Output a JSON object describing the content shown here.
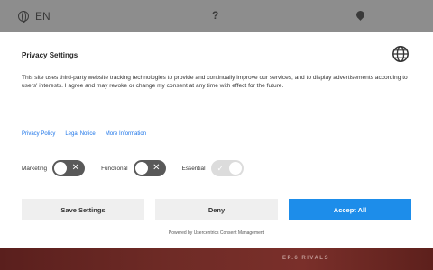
{
  "background": {
    "language": "EN",
    "help": "?",
    "bottom_tag": "EP.6 RIVALS"
  },
  "dialog": {
    "title": "Privacy Settings",
    "description": "This site uses third-party website tracking technologies to provide and continually improve our services, and to display advertisements according to users' interests. I agree and may revoke or change my consent at any time with effect for the future.",
    "links": [
      "Privacy Policy",
      "Legal Notice",
      "More Information"
    ],
    "toggles": [
      {
        "label": "Marketing",
        "state": "off"
      },
      {
        "label": "Functional",
        "state": "off"
      },
      {
        "label": "Essential",
        "state": "on-disabled"
      }
    ],
    "buttons": {
      "save": "Save Settings",
      "deny": "Deny",
      "accept": "Accept All"
    },
    "powered_by": "Powered by Usercentrics Consent Management"
  },
  "colors": {
    "accent": "#1d8dea",
    "toggle_off": "#595959",
    "link": "#1a73e8"
  },
  "icons": {
    "language": "globe-icon",
    "toggle_off": "x-icon",
    "toggle_on": "check-icon"
  }
}
